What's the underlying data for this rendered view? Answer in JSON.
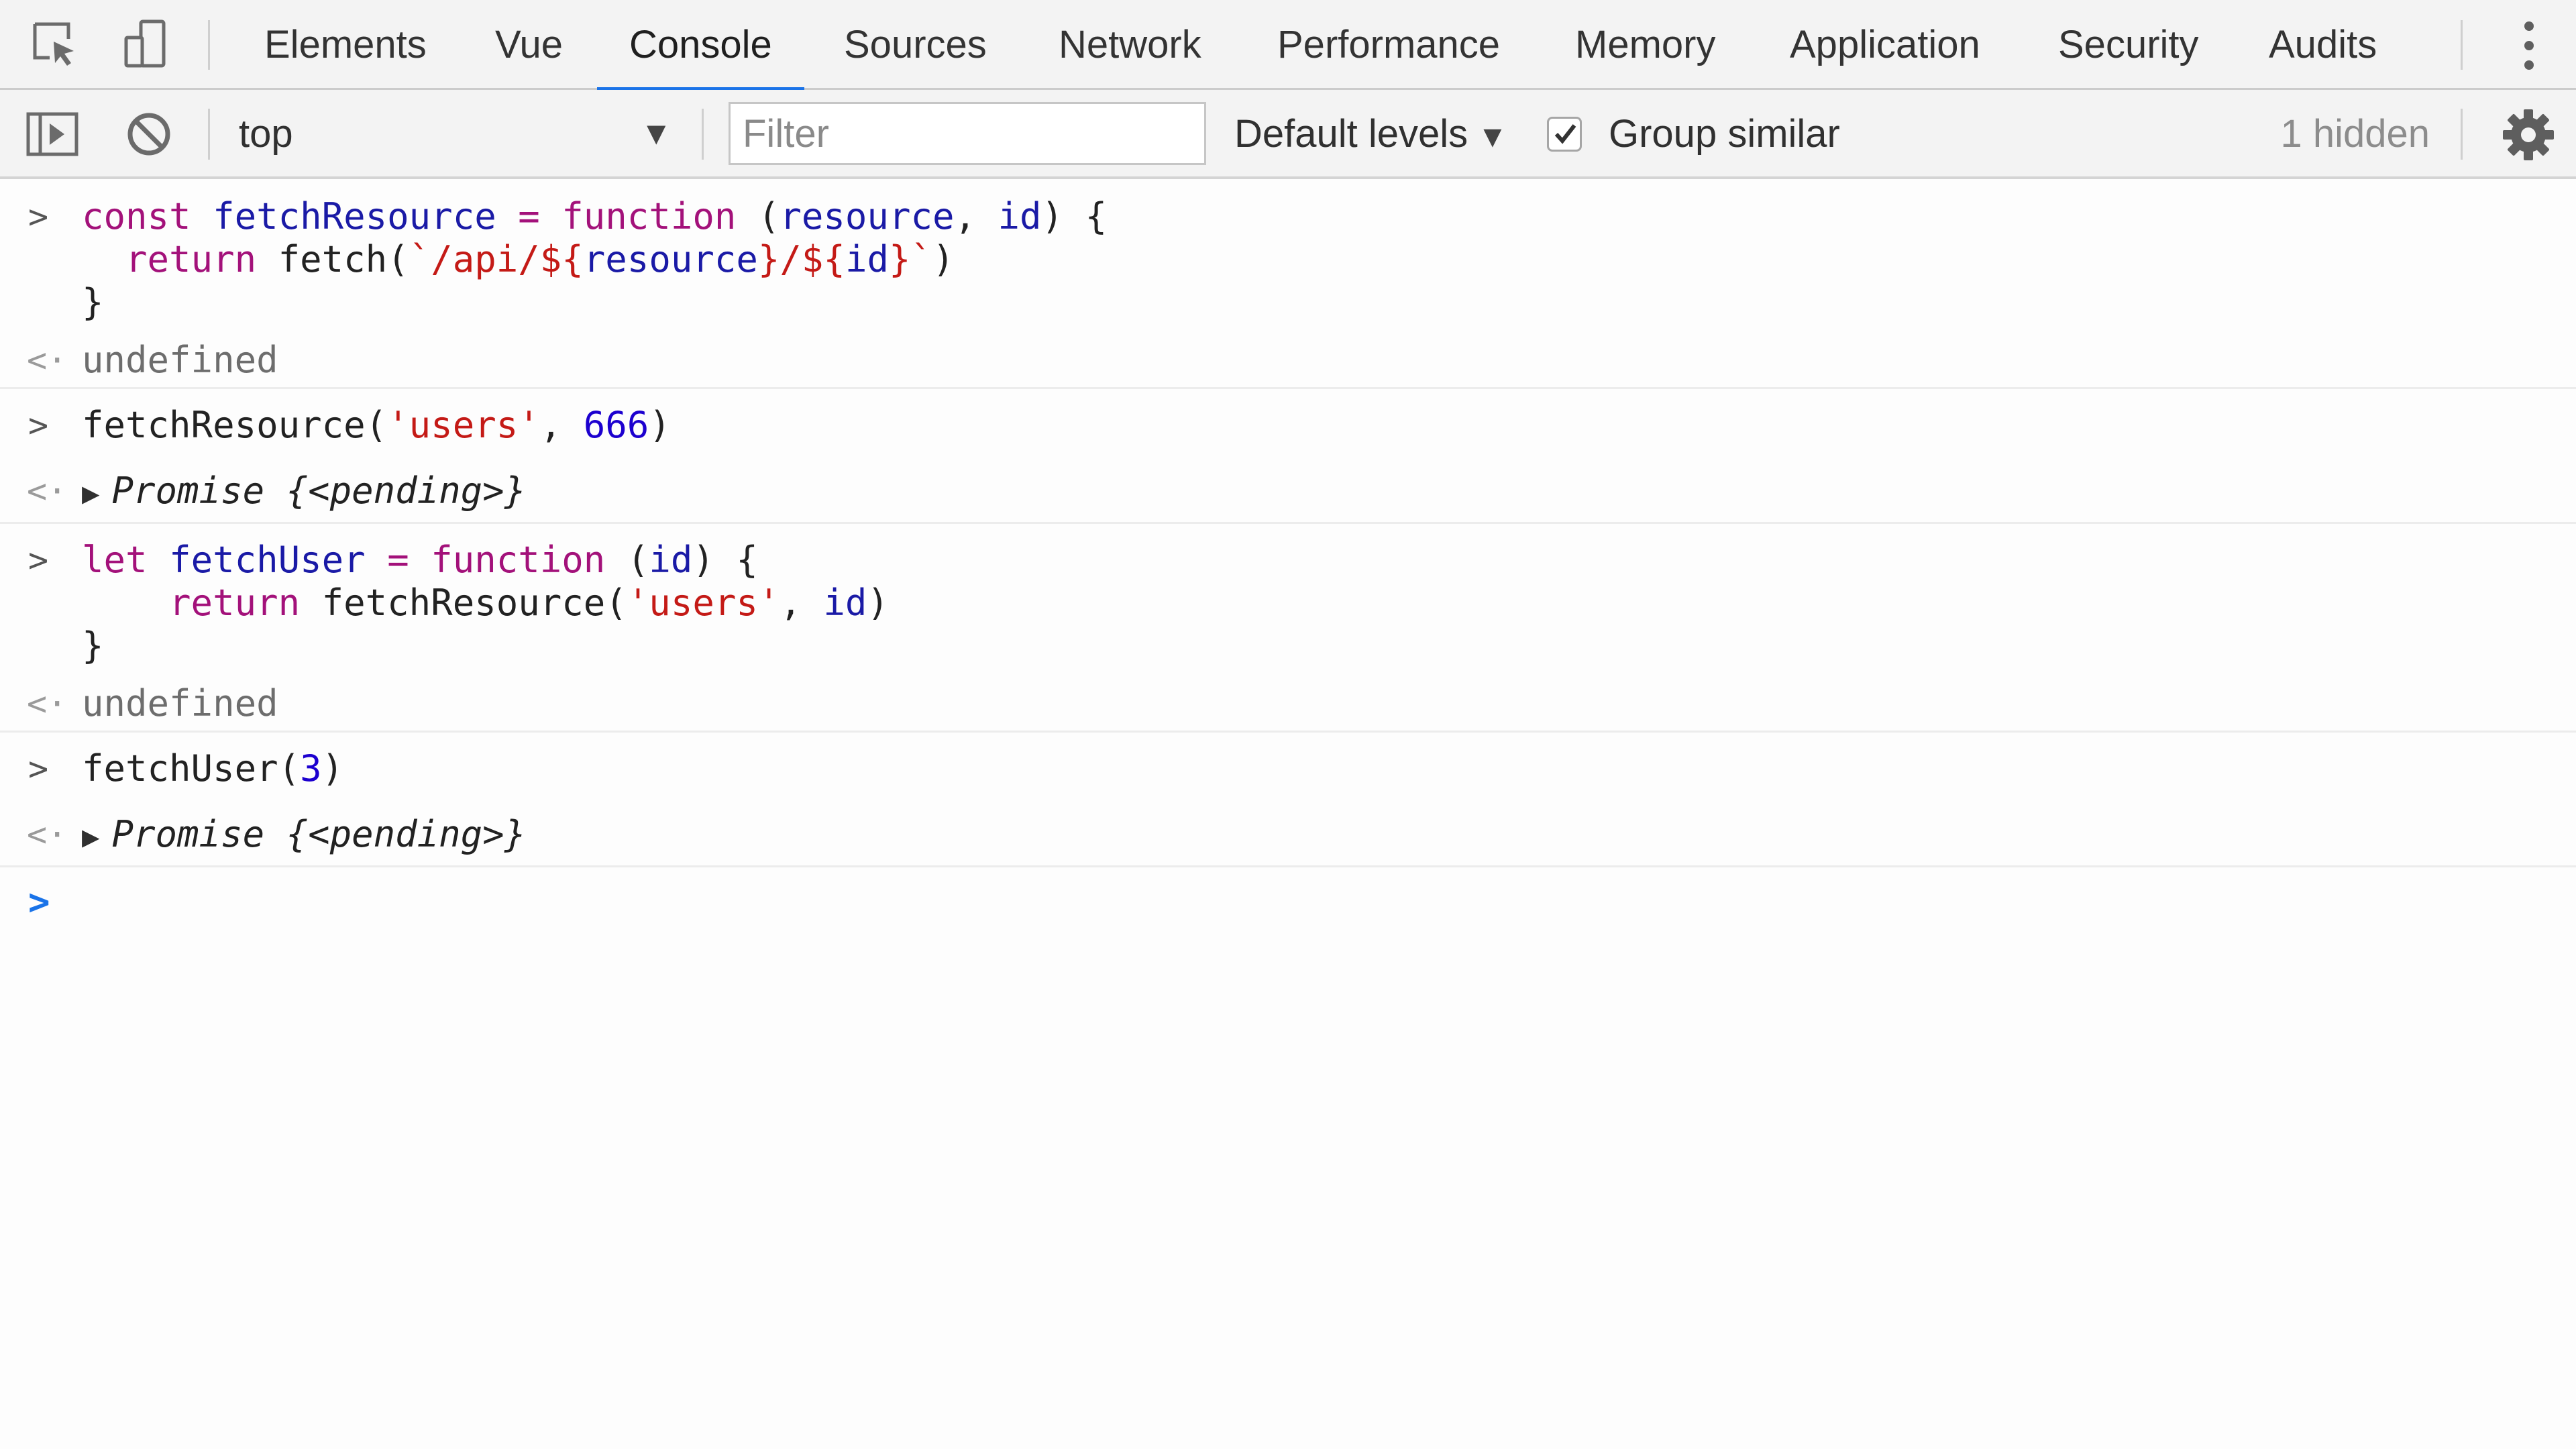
{
  "tabs": [
    "Elements",
    "Vue",
    "Console",
    "Sources",
    "Network",
    "Performance",
    "Memory",
    "Application",
    "Security",
    "Audits"
  ],
  "active_tab": "Console",
  "toolbar": {
    "context": "top",
    "filter_placeholder": "Filter",
    "levels_label": "Default levels",
    "group_similar_label": "Group similar",
    "group_similar_checked": true,
    "hidden_count": "1 hidden"
  },
  "console": {
    "entries": [
      {
        "input_lines": [
          "const fetchResource = function (resource, id) {",
          "  return fetch(`/api/${resource}/${id}`)",
          "}"
        ],
        "result": "undefined"
      },
      {
        "input_lines": [
          "fetchResource('users', 666)"
        ],
        "result": "Promise {<pending>}"
      },
      {
        "input_lines": [
          "let fetchUser = function (id) {",
          "    return fetchResource('users', id)",
          "}"
        ],
        "result": "undefined"
      },
      {
        "input_lines": [
          "fetchUser(3)"
        ],
        "result": "Promise {<pending>}"
      }
    ]
  },
  "colors": {
    "accent": "#1a73e8",
    "keyword": "#a3117a",
    "identifier": "#1a1aa6",
    "string": "#c41a16",
    "number": "#1c00cf"
  },
  "icons": [
    "inspect-element-icon",
    "device-toolbar-icon",
    "more-options-icon",
    "sidebar-toggle-icon",
    "clear-console-icon",
    "settings-gear-icon"
  ]
}
